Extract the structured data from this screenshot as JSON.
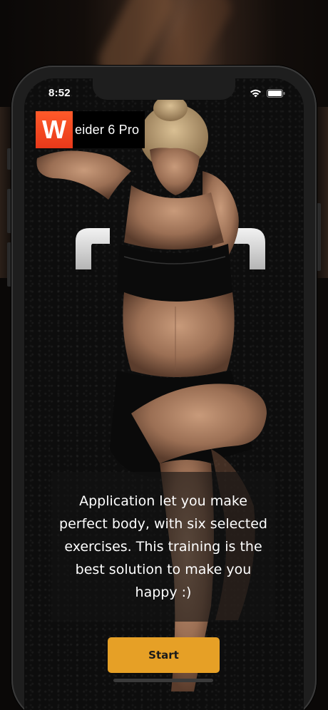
{
  "status_bar": {
    "time": "8:52",
    "icons": [
      "wifi-icon",
      "battery-icon"
    ]
  },
  "app": {
    "logo_letter": "W",
    "logo_text": "eider 6 Pro"
  },
  "hero": {
    "icon": "athlete-photo"
  },
  "description": {
    "text": "Application let you make perfect body, with six selected exercises. This training is the best solution to make you happy :)"
  },
  "actions": {
    "start_label": "Start"
  },
  "colors": {
    "accent": "#e6a026",
    "logo_red": "#e8391a",
    "background": "#0d0d0d"
  }
}
